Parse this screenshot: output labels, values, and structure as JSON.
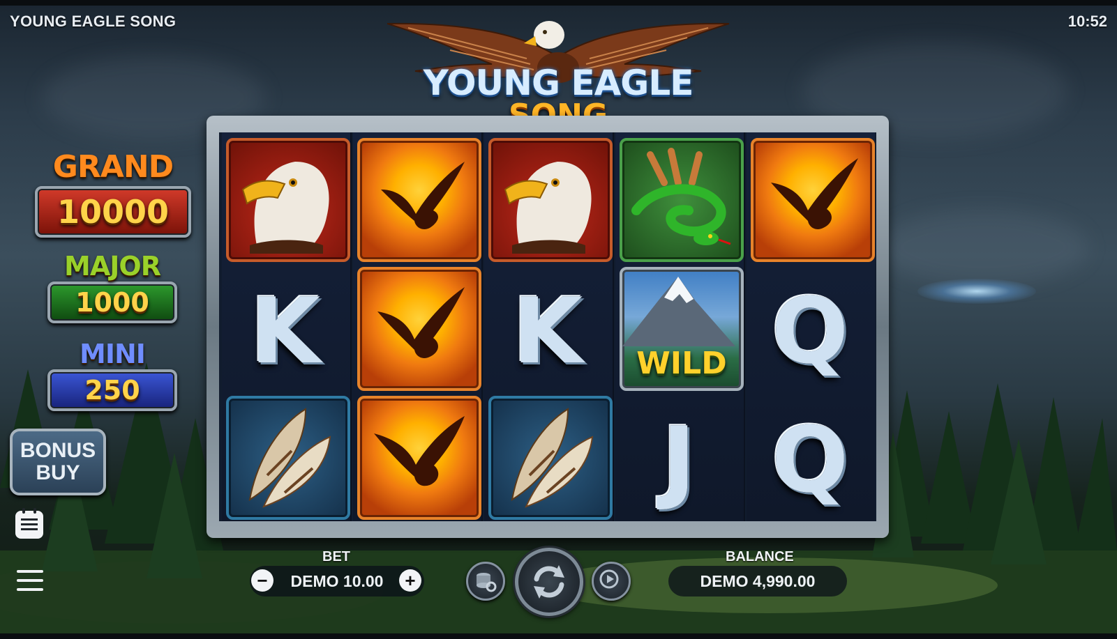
{
  "header": {
    "game_title": "YOUNG EAGLE SONG",
    "clock": "10:52"
  },
  "logo": {
    "line1": "YOUNG EAGLE",
    "line2": "SONG"
  },
  "jackpots": [
    {
      "label": "GRAND",
      "value": "10000",
      "label_color": "#ff8a1e",
      "box_color": "#b3201a"
    },
    {
      "label": "MAJOR",
      "value": "1000",
      "label_color": "#9ad12a",
      "box_color": "#1f7a1f"
    },
    {
      "label": "MINI",
      "value": "250",
      "label_color": "#6f8dff",
      "box_color": "#2a3fb0"
    }
  ],
  "bonus_buy": {
    "line1": "BONUS",
    "line2": "BUY"
  },
  "reels": [
    [
      "eagle-head",
      "K",
      "feathers"
    ],
    [
      "eagle-sun",
      "eagle-sun",
      "eagle-sun"
    ],
    [
      "eagle-head",
      "K",
      "feathers"
    ],
    [
      "eagle-snake",
      "WILD",
      "J"
    ],
    [
      "eagle-sun",
      "Q",
      "Q"
    ]
  ],
  "wild": {
    "label": "WILD"
  },
  "bet": {
    "label": "BET",
    "value": "DEMO 10.00",
    "minus": "−",
    "plus": "+"
  },
  "balance": {
    "label": "BALANCE",
    "value": "DEMO 4,990.00"
  },
  "icons": [
    "paytable-icon",
    "menu-icon",
    "coin-settings-icon",
    "spin-icon",
    "autoplay-icon"
  ]
}
